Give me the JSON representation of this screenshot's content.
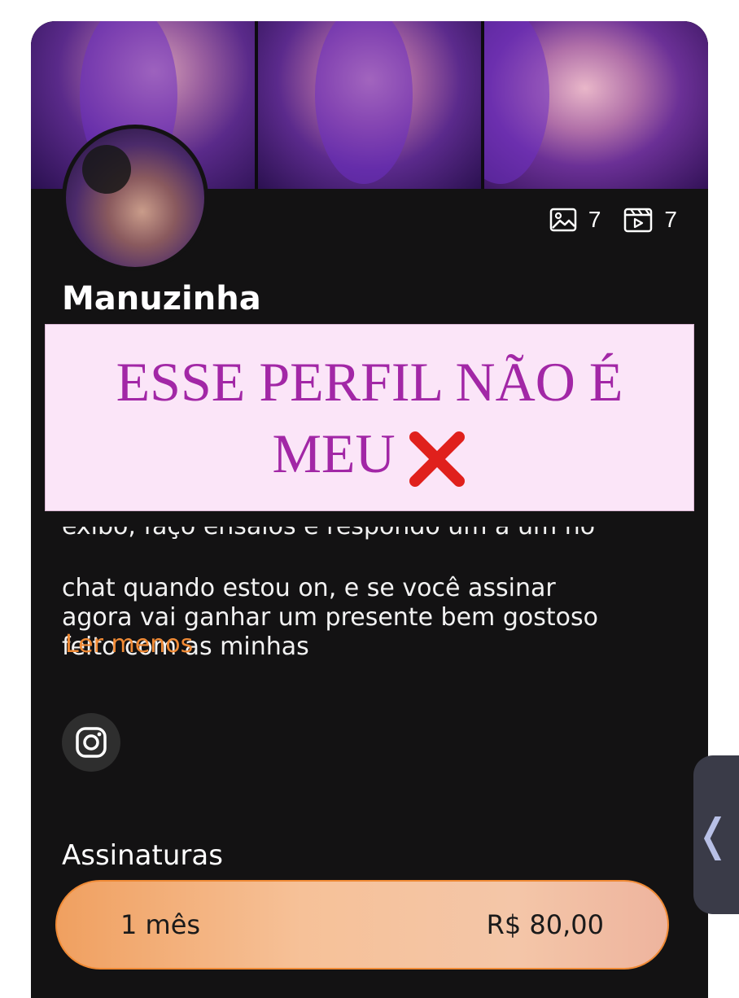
{
  "profile": {
    "name": "Manuzinha",
    "photos_count": "7",
    "videos_count": "7",
    "bio_cut_line": "exibo, faço ensaios e respondo um a um no",
    "bio_lines": "chat quando estou on, e se você assinar\nagora vai ganhar um presente bem gostoso\nfeito com as minhas",
    "read_less": "Ler menos"
  },
  "overlay": {
    "line1": "ESSE PERFIL NÃO É",
    "line2": "MEU"
  },
  "subscriptions": {
    "title": "Assinaturas",
    "plans": [
      {
        "duration": "1 mês",
        "price": "R$ 80,00"
      }
    ]
  },
  "side_tab": {
    "glyph": "❬"
  },
  "icons": [
    "image-icon",
    "video-icon",
    "instagram-icon",
    "cross-mark-icon",
    "chevron-left-icon"
  ],
  "colors": {
    "background": "#131213",
    "accent": "#f08a35",
    "overlay_text": "#a227a6",
    "overlay_bg": "#fbe5f8"
  }
}
